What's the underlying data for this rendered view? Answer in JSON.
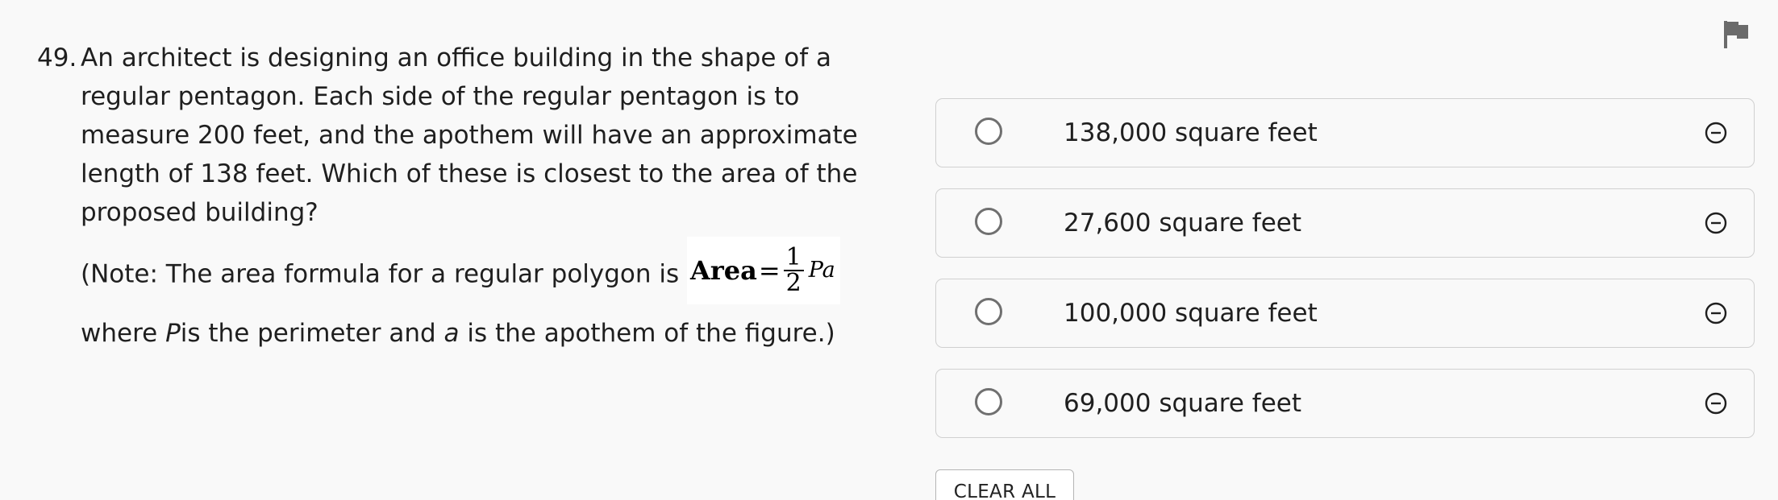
{
  "question": {
    "number": "49.",
    "stem": "An architect is designing an office building in the shape of a regular pentagon. Each side of the regular pentagon is to measure 200 feet, and the apothem will have an approximate length of 138 feet. Which of these is closest to the area of the proposed building?",
    "note_prefix": "(Note: The area formula for a regular polygon is ",
    "formula": {
      "word": "Area",
      "eq": "=",
      "numerator": "1",
      "denominator": "2",
      "vars": "Pa"
    },
    "note_line2_where": "where ",
    "note_line2_P": "P",
    "note_line2_mid": "is the perimeter and ",
    "note_line2_a": "a",
    "note_line2_end": " is the apothem of the figure.)"
  },
  "choices": [
    {
      "label": "138,000 square feet"
    },
    {
      "label": "27,600 square feet"
    },
    {
      "label": "100,000 square feet"
    },
    {
      "label": "69,000 square feet"
    }
  ],
  "clear_all_label": "CLEAR ALL",
  "icons": {
    "flag": "flag-icon",
    "eliminate": "eliminate-icon",
    "radio": "radio-icon"
  },
  "colors": {
    "background": "#f9f9f9",
    "border": "#d0d0d0",
    "radio": "#707070",
    "flag": "#6b6b6b"
  }
}
